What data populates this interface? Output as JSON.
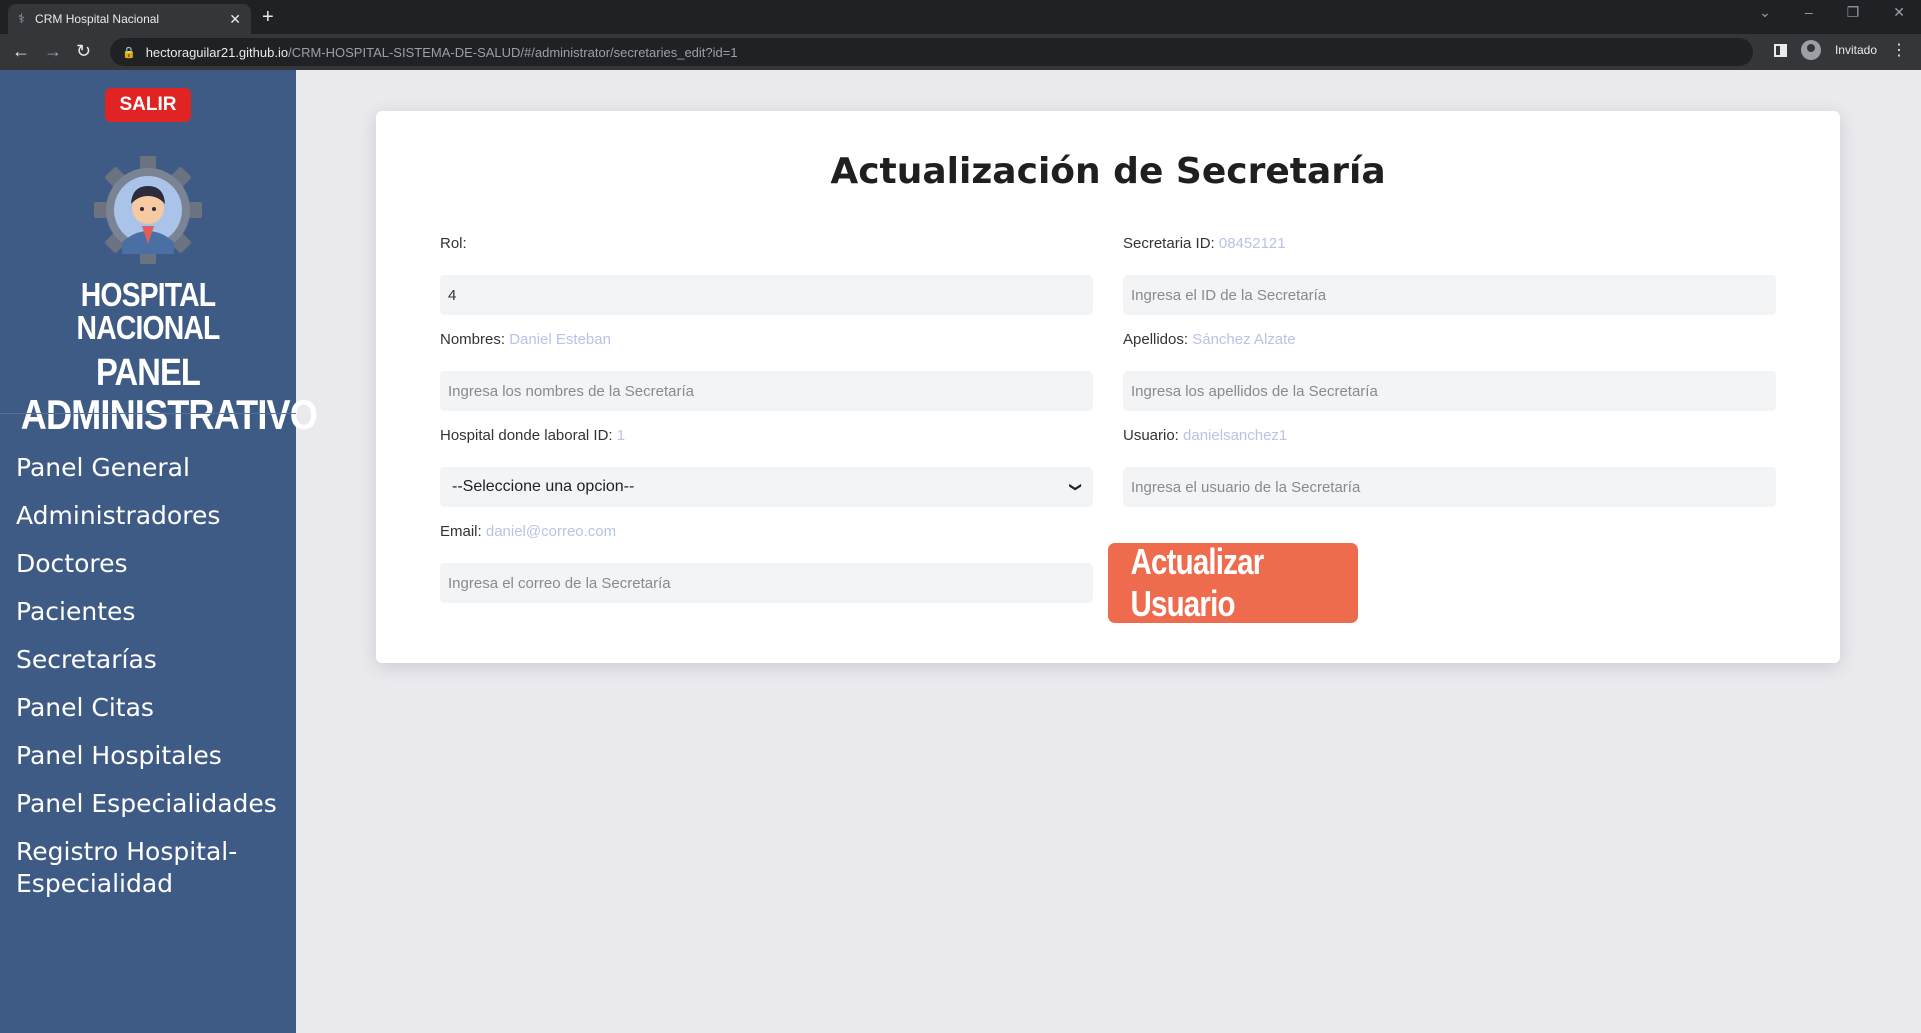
{
  "browser": {
    "tab_title": "CRM Hospital Nacional",
    "tab_close": "✕",
    "new_tab": "+",
    "url_host": "hectoraguilar21.github.io",
    "url_path": "/CRM-HOSPITAL-SISTEMA-DE-SALUD/#/administrator/secretaries_edit?id=1",
    "profile_label": "Invitado"
  },
  "sidebar": {
    "logout_label": "SALIR",
    "brand_line1": "HOSPITAL NACIONAL",
    "brand_line2": "PANEL",
    "brand_line3": "ADMINISTRATIVO",
    "items": [
      {
        "label": "Panel General"
      },
      {
        "label": "Administradores"
      },
      {
        "label": "Doctores"
      },
      {
        "label": "Pacientes"
      },
      {
        "label": "Secretarías"
      },
      {
        "label": "Panel Citas"
      },
      {
        "label": "Panel Hospitales"
      },
      {
        "label": "Panel Especialidades"
      },
      {
        "label": "Registro Hospital-Especialidad"
      }
    ]
  },
  "form": {
    "title": "Actualización de Secretaría",
    "rol": {
      "label": "Rol:",
      "value": "4"
    },
    "secretaria_id": {
      "label": "Secretaria ID:",
      "hint": "08452121",
      "placeholder": "Ingresa el ID de la Secretaría"
    },
    "nombres": {
      "label": "Nombres:",
      "hint": "Daniel Esteban",
      "placeholder": "Ingresa los nombres de la Secretaría"
    },
    "apellidos": {
      "label": "Apellidos:",
      "hint": "Sánchez Alzate",
      "placeholder": "Ingresa los apellidos de la Secretaría"
    },
    "hospital": {
      "label": "Hospital donde laboral ID:",
      "hint": "1",
      "selected": "--Seleccione una opcion--"
    },
    "usuario": {
      "label": "Usuario:",
      "hint": "danielsanchez1",
      "placeholder": "Ingresa el usuario de la Secretaría"
    },
    "email": {
      "label": "Email:",
      "hint": "daniel@correo.com",
      "placeholder": "Ingresa el correo de la Secretaría"
    },
    "submit_label": "Actualizar Usuario"
  }
}
